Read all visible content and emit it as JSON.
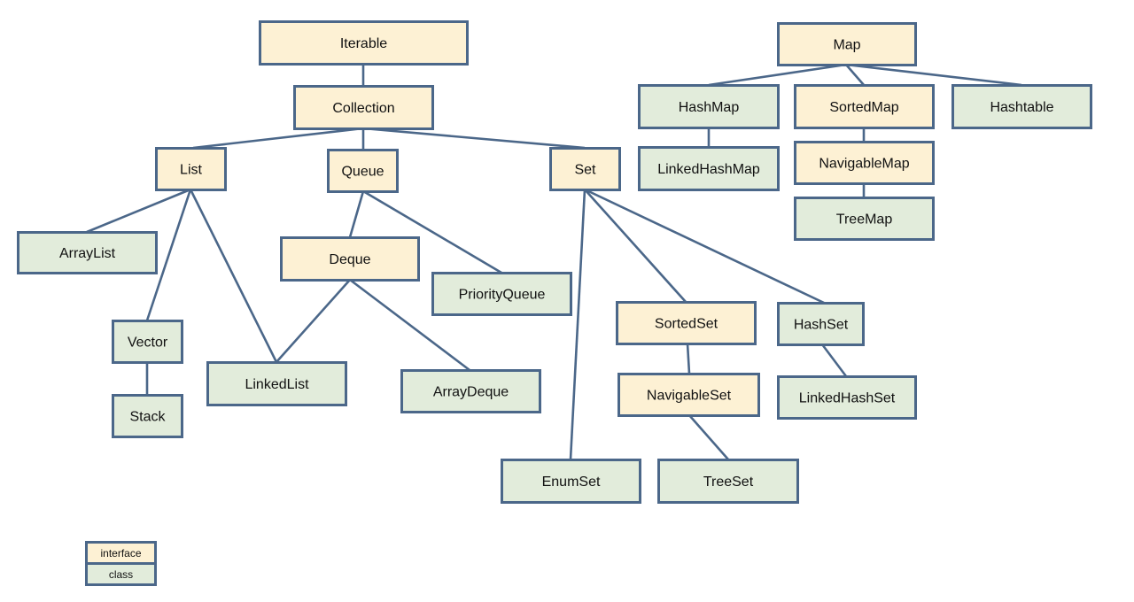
{
  "colors": {
    "interface": "#fdf1d4",
    "class": "#e2ecdb",
    "border": "#4b6789"
  },
  "nodes": {
    "iterable": {
      "label": "Iterable",
      "kind": "interface"
    },
    "collection": {
      "label": "Collection",
      "kind": "interface"
    },
    "list": {
      "label": "List",
      "kind": "interface"
    },
    "queue": {
      "label": "Queue",
      "kind": "interface"
    },
    "set": {
      "label": "Set",
      "kind": "interface"
    },
    "arraylist": {
      "label": "ArrayList",
      "kind": "class"
    },
    "deque": {
      "label": "Deque",
      "kind": "interface"
    },
    "priorityqueue": {
      "label": "PriorityQueue",
      "kind": "class"
    },
    "vector": {
      "label": "Vector",
      "kind": "class"
    },
    "linkedlist": {
      "label": "LinkedList",
      "kind": "class"
    },
    "arraydeque": {
      "label": "ArrayDeque",
      "kind": "class"
    },
    "stack": {
      "label": "Stack",
      "kind": "class"
    },
    "sortedset": {
      "label": "SortedSet",
      "kind": "interface"
    },
    "hashset": {
      "label": "HashSet",
      "kind": "class"
    },
    "navigableset": {
      "label": "NavigableSet",
      "kind": "interface"
    },
    "linkedhashset": {
      "label": "LinkedHashSet",
      "kind": "class"
    },
    "enumset": {
      "label": "EnumSet",
      "kind": "class"
    },
    "treeset": {
      "label": "TreeSet",
      "kind": "class"
    },
    "map": {
      "label": "Map",
      "kind": "interface"
    },
    "hashmap": {
      "label": "HashMap",
      "kind": "class"
    },
    "sortedmap": {
      "label": "SortedMap",
      "kind": "interface"
    },
    "hashtable": {
      "label": "Hashtable",
      "kind": "class"
    },
    "linkedhashmap": {
      "label": "LinkedHashMap",
      "kind": "class"
    },
    "navigablemap": {
      "label": "NavigableMap",
      "kind": "interface"
    },
    "treemap": {
      "label": "TreeMap",
      "kind": "class"
    }
  },
  "edges": [
    [
      "iterable",
      "collection"
    ],
    [
      "collection",
      "list"
    ],
    [
      "collection",
      "queue"
    ],
    [
      "collection",
      "set"
    ],
    [
      "list",
      "arraylist"
    ],
    [
      "list",
      "vector"
    ],
    [
      "list",
      "linkedlist"
    ],
    [
      "queue",
      "deque"
    ],
    [
      "queue",
      "priorityqueue"
    ],
    [
      "deque",
      "linkedlist"
    ],
    [
      "deque",
      "arraydeque"
    ],
    [
      "vector",
      "stack"
    ],
    [
      "set",
      "enumset"
    ],
    [
      "set",
      "sortedset"
    ],
    [
      "set",
      "hashset"
    ],
    [
      "sortedset",
      "navigableset"
    ],
    [
      "navigableset",
      "treeset"
    ],
    [
      "hashset",
      "linkedhashset"
    ],
    [
      "map",
      "hashmap"
    ],
    [
      "map",
      "sortedmap"
    ],
    [
      "map",
      "hashtable"
    ],
    [
      "hashmap",
      "linkedhashmap"
    ],
    [
      "sortedmap",
      "navigablemap"
    ],
    [
      "navigablemap",
      "treemap"
    ]
  ],
  "legend": {
    "interface": "interface",
    "class": "class"
  }
}
